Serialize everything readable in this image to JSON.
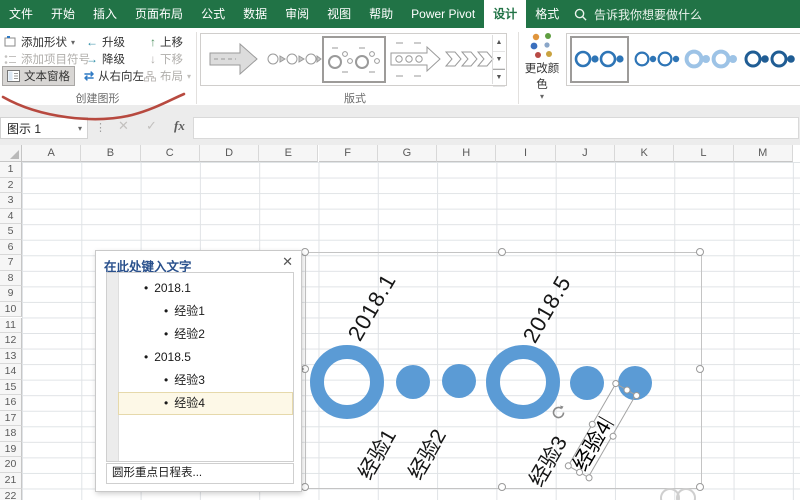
{
  "ribbon": {
    "tabs": [
      {
        "label": "文件",
        "active": false
      },
      {
        "label": "开始",
        "active": false
      },
      {
        "label": "插入",
        "active": false
      },
      {
        "label": "页面布局",
        "active": false
      },
      {
        "label": "公式",
        "active": false
      },
      {
        "label": "数据",
        "active": false
      },
      {
        "label": "审阅",
        "active": false
      },
      {
        "label": "视图",
        "active": false
      },
      {
        "label": "帮助",
        "active": false
      },
      {
        "label": "Power Pivot",
        "active": false
      },
      {
        "label": "设计",
        "active": true
      },
      {
        "label": "格式",
        "active": false
      }
    ],
    "search_label": "告诉我你想要做什么",
    "create_graphic": {
      "group_label": "创建图形",
      "add_shape": "添加形状",
      "add_bullet": "添加项目符号",
      "text_pane": "文本窗格",
      "promote": "升级",
      "demote": "降级",
      "right_to_left": "从右向左",
      "move_up": "上移",
      "move_down": "下移",
      "layout": "布局"
    },
    "layouts_group_label": "版式",
    "change_colors": "更改颜色"
  },
  "formula_bar": {
    "name_box": "图示 1",
    "fx": "fx"
  },
  "grid": {
    "columns": [
      "A",
      "B",
      "C",
      "D",
      "E",
      "F",
      "G",
      "H",
      "I",
      "J",
      "K",
      "L",
      "M"
    ],
    "row_count": 22
  },
  "text_pane": {
    "title": "在此处键入文字",
    "items": [
      {
        "text": "2018.1",
        "level": 1,
        "highlight": false
      },
      {
        "text": "经验1",
        "level": 2,
        "highlight": false
      },
      {
        "text": "经验2",
        "level": 2,
        "highlight": false
      },
      {
        "text": "2018.5",
        "level": 1,
        "highlight": false
      },
      {
        "text": "经验3",
        "level": 2,
        "highlight": false
      },
      {
        "text": "经验4",
        "level": 2,
        "highlight": true
      }
    ],
    "footer": "圆形重点日程表..."
  },
  "smartart": {
    "milestones": [
      "2018.1",
      "2018.5"
    ],
    "entries": [
      "经验1",
      "经验2",
      "经验3",
      "经验4"
    ]
  },
  "colors": {
    "excel_green": "#217346",
    "accent_blue": "#5b9bd5",
    "annotation_red": "#b23b30",
    "highlight_bg": "#fdf8e7"
  }
}
